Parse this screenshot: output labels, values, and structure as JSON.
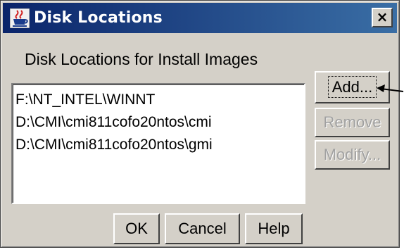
{
  "window": {
    "title": "Disk Locations",
    "close_symbol": "×",
    "icon": "java-cup-icon"
  },
  "group_label": "Disk Locations for Install Images",
  "locations": [
    "F:\\NT_INTEL\\WINNT",
    "D:\\CMI\\cmi811cofo20ntos\\cmi",
    "D:\\CMI\\cmi811cofo20ntos\\gmi"
  ],
  "side_buttons": {
    "add": "Add...",
    "remove": "Remove",
    "modify": "Modify..."
  },
  "bottom_buttons": {
    "ok": "OK",
    "cancel": "Cancel",
    "help": "Help"
  }
}
